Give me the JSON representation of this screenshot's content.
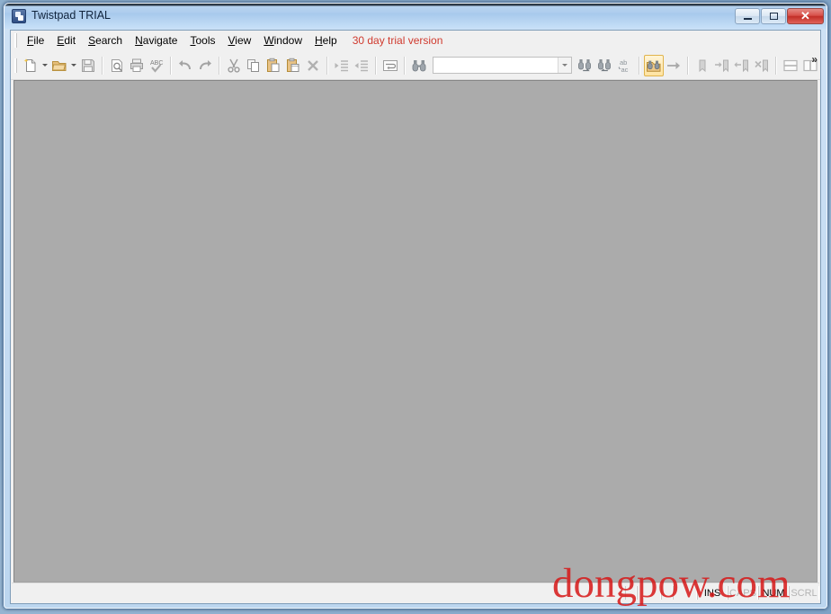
{
  "window": {
    "title": "Twistpad TRIAL",
    "icon": "app-icon",
    "caption_buttons": {
      "minimize": "–",
      "maximize": "□",
      "close": "✕"
    }
  },
  "menubar": {
    "items": [
      {
        "label": "File",
        "accel": "F"
      },
      {
        "label": "Edit",
        "accel": "E"
      },
      {
        "label": "Search",
        "accel": "S"
      },
      {
        "label": "Navigate",
        "accel": "N"
      },
      {
        "label": "Tools",
        "accel": "T"
      },
      {
        "label": "View",
        "accel": "V"
      },
      {
        "label": "Window",
        "accel": "W"
      },
      {
        "label": "Help",
        "accel": "H"
      }
    ],
    "trial_notice": "30 day trial version",
    "trial_color": "#d03a2e"
  },
  "toolbar": {
    "search_value": "",
    "search_placeholder": "",
    "overflow_label": "»",
    "buttons": [
      {
        "name": "new-file-icon",
        "tooltip": "New"
      },
      {
        "name": "open-file-icon",
        "tooltip": "Open"
      },
      {
        "name": "save-icon",
        "tooltip": "Save"
      },
      {
        "name": "print-preview-icon",
        "tooltip": "Print Preview"
      },
      {
        "name": "print-icon",
        "tooltip": "Print"
      },
      {
        "name": "spell-check-icon",
        "tooltip": "Spell Check"
      },
      {
        "name": "undo-icon",
        "tooltip": "Undo"
      },
      {
        "name": "redo-icon",
        "tooltip": "Redo"
      },
      {
        "name": "cut-icon",
        "tooltip": "Cut"
      },
      {
        "name": "copy-icon",
        "tooltip": "Copy"
      },
      {
        "name": "paste-icon",
        "tooltip": "Paste"
      },
      {
        "name": "paste-special-icon",
        "tooltip": "Paste Special"
      },
      {
        "name": "delete-icon",
        "tooltip": "Delete"
      },
      {
        "name": "indent-icon",
        "tooltip": "Indent"
      },
      {
        "name": "outdent-icon",
        "tooltip": "Outdent"
      },
      {
        "name": "word-wrap-icon",
        "tooltip": "Word Wrap"
      },
      {
        "name": "find-icon",
        "tooltip": "Find"
      },
      {
        "name": "find-next-icon",
        "tooltip": "Find Next"
      },
      {
        "name": "find-previous-icon",
        "tooltip": "Find Previous"
      },
      {
        "name": "replace-icon",
        "tooltip": "Replace"
      },
      {
        "name": "find-in-files-icon",
        "tooltip": "Find in Files",
        "active": true
      },
      {
        "name": "go-to-icon",
        "tooltip": "Go To"
      },
      {
        "name": "bookmark-toggle-icon",
        "tooltip": "Toggle Bookmark"
      },
      {
        "name": "bookmark-next-icon",
        "tooltip": "Next Bookmark"
      },
      {
        "name": "bookmark-prev-icon",
        "tooltip": "Previous Bookmark"
      },
      {
        "name": "bookmark-clear-icon",
        "tooltip": "Clear Bookmarks"
      },
      {
        "name": "split-horizontal-icon",
        "tooltip": "Split Horizontal"
      },
      {
        "name": "split-vertical-icon",
        "tooltip": "Split Vertical"
      }
    ]
  },
  "workspace": {
    "background_color": "#ababab",
    "open_documents": []
  },
  "statusbar": {
    "message": "",
    "panes": [
      "",
      "",
      "",
      ""
    ],
    "indicators": [
      {
        "label": "INS",
        "enabled": true
      },
      {
        "label": "CAPS",
        "enabled": false
      },
      {
        "label": "NUM",
        "enabled": true
      },
      {
        "label": "SCRL",
        "enabled": false
      }
    ]
  },
  "watermark": {
    "text": "dongpow.com",
    "color": "#d61919"
  }
}
